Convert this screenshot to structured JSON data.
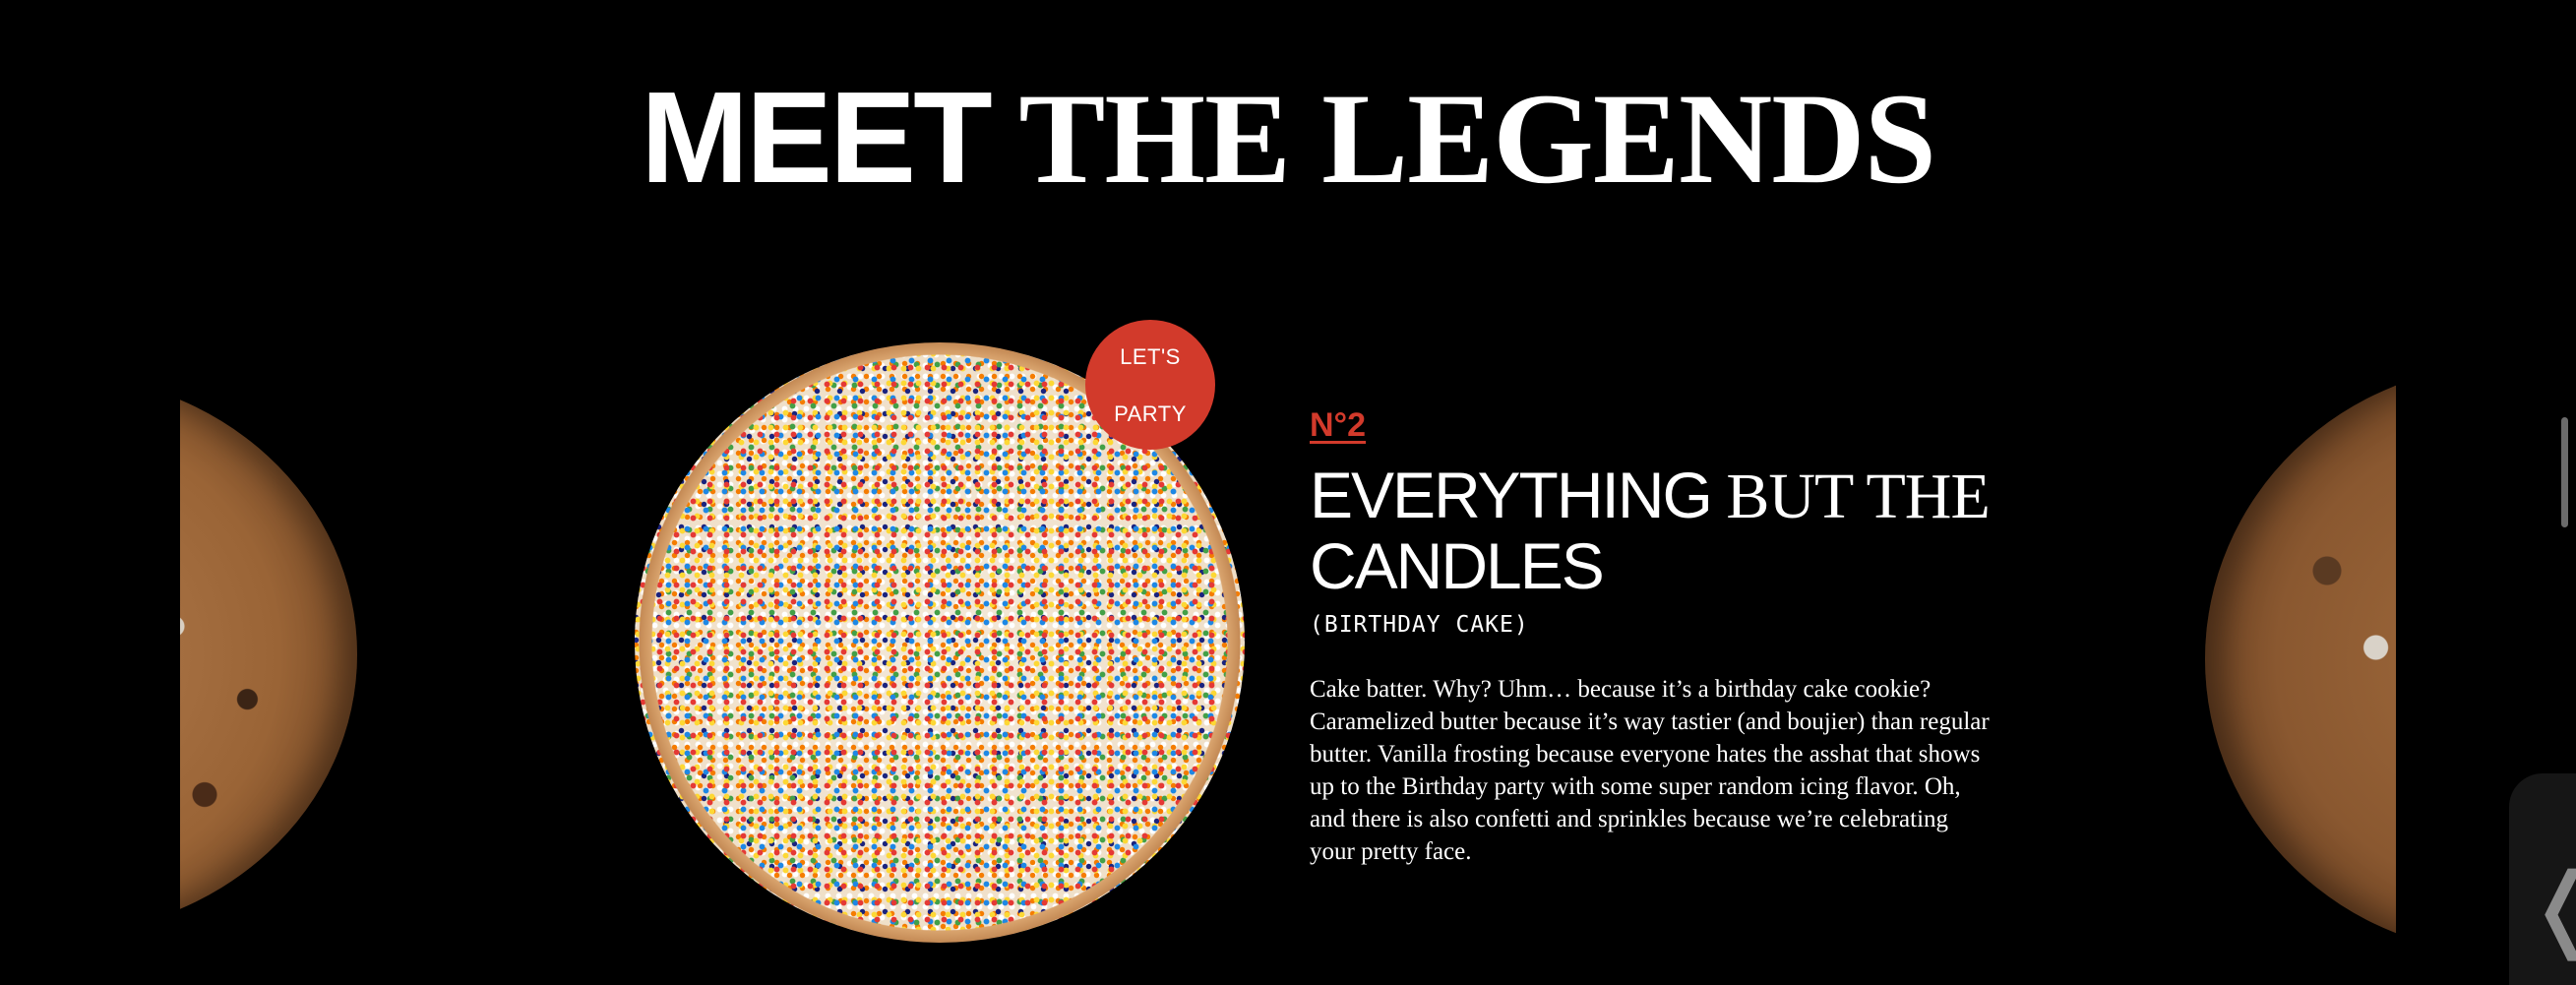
{
  "heading": {
    "part1": "MEET",
    "part2": " THE LEGENDS"
  },
  "product": {
    "badge_line1": "LET'S",
    "badge_line2": "PARTY",
    "number": "N°2",
    "title_part1": "EVERYTHING",
    "title_part2": " BUT THE",
    "title_part3": "CANDLES",
    "subtitle": "(BIRTHDAY CAKE)",
    "description": "Cake batter. Why? Uhm… because it’s a birthday cake cookie? Caramelized butter because it’s way tastier (and boujier) than regular butter. Vanilla frosting because everyone hates the asshat that shows up to the Birthday party with some super random icing flavor. Oh, and there is also confetti and sprinkles because we’re celebrating your pretty face."
  },
  "side_tab": {
    "icon": "chevron-left-icon",
    "glyph": "❬"
  },
  "colors": {
    "background": "#000000",
    "accent": "#d23a2b",
    "text": "#ffffff"
  }
}
